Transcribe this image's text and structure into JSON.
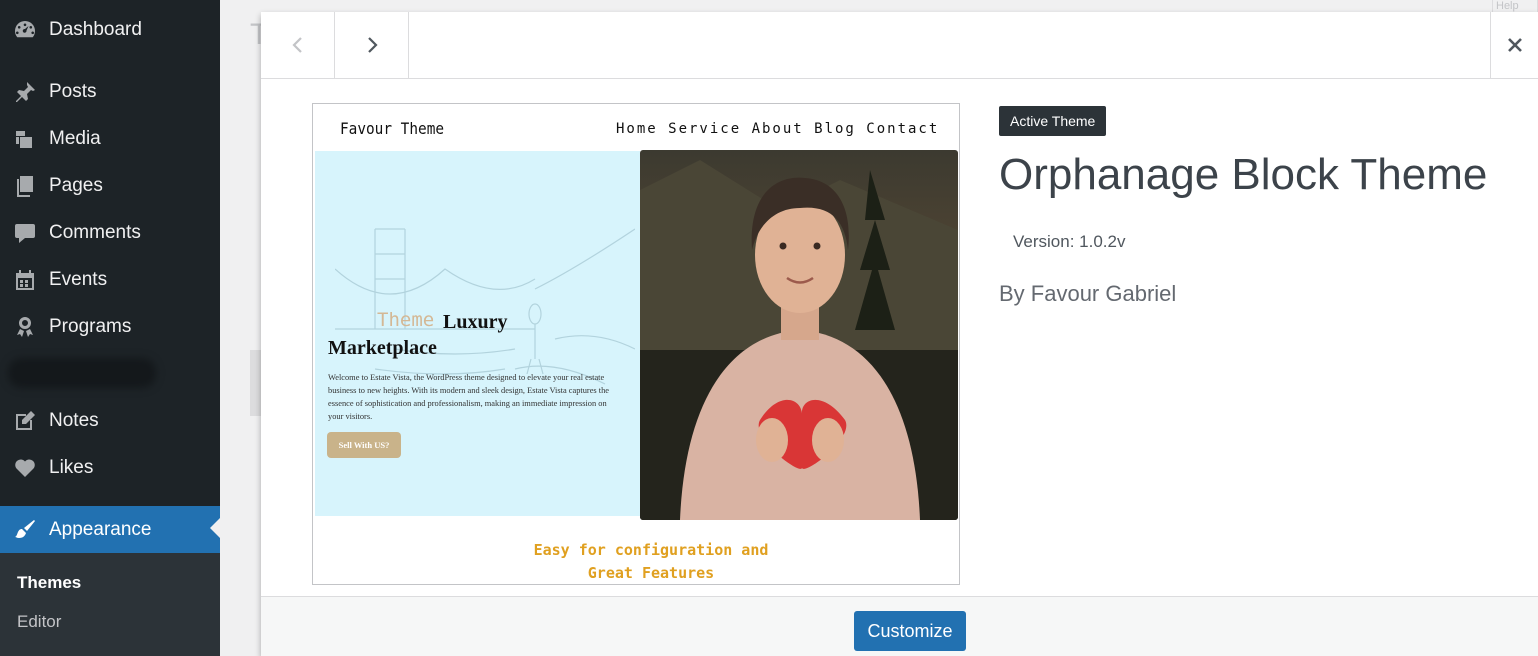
{
  "sidebar": {
    "items": [
      {
        "label": "Dashboard",
        "icon": "dashboard-icon"
      },
      {
        "label": "Posts",
        "icon": "pin-icon"
      },
      {
        "label": "Media",
        "icon": "media-icon"
      },
      {
        "label": "Pages",
        "icon": "pages-icon"
      },
      {
        "label": "Comments",
        "icon": "comment-icon"
      },
      {
        "label": "Events",
        "icon": "calendar-icon"
      },
      {
        "label": "Programs",
        "icon": "award-icon"
      },
      {
        "label": "Notes",
        "icon": "edit-icon"
      },
      {
        "label": "Likes",
        "icon": "heart-icon"
      },
      {
        "label": "Appearance",
        "icon": "paintbrush-icon"
      }
    ],
    "submenu": [
      {
        "label": "Themes"
      },
      {
        "label": "Editor"
      }
    ]
  },
  "background": {
    "title_fragment": "T",
    "help_fragment": "Help"
  },
  "modal": {
    "screenshot": {
      "brand": "Favour Theme",
      "nav": "Home  Service About Blog Contact",
      "heading_accent": "Theme",
      "heading_word": "Luxury",
      "heading_line2": "Marketplace",
      "description": "Welcome to Estate Vista, the WordPress theme designed to elevate your real estate business to new heights. With its modern and sleek design, Estate Vista captures the essence of sophistication and professionalism, making an immediate impression on your visitors.",
      "cta": "Sell With US?",
      "features_line1": "Easy for configuration and",
      "features_line2": "Great Features"
    },
    "badge": "Active Theme",
    "theme_name": "Orphanage Block Theme",
    "version": "Version: 1.0.2v",
    "author": "By Favour Gabriel",
    "customize_label": "Customize"
  },
  "colors": {
    "sidebar_bg": "#1d2327",
    "accent": "#2271b1",
    "badge_bg": "#2c3338"
  }
}
